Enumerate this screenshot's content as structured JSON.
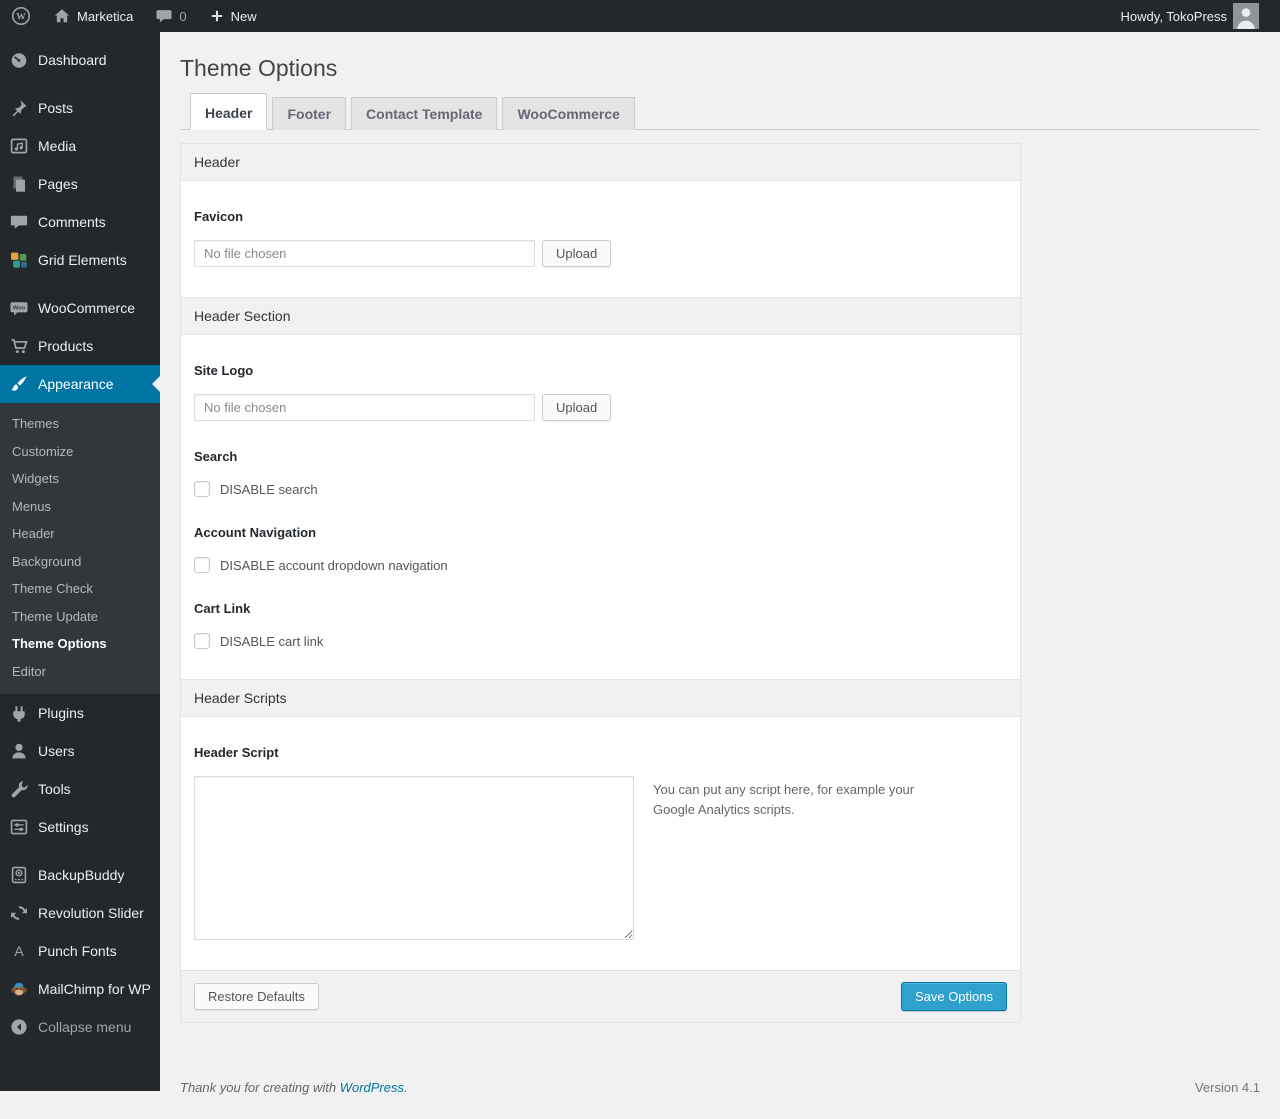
{
  "colors": {
    "admin_bar_bg": "#23282d",
    "sidebar_bg": "#23282d",
    "submenu_bg": "#32373c",
    "accent": "#0074a2",
    "primary_button": "#2ea2cc",
    "content_bg": "#f1f1f1"
  },
  "admin_bar": {
    "site_name": "Marketica",
    "comment_count": "0",
    "new_label": "New",
    "howdy": "Howdy, TokoPress"
  },
  "sidebar": {
    "items": [
      {
        "label": "Dashboard",
        "icon": "dashboard-icon"
      },
      {
        "label": "Posts",
        "icon": "pin-icon"
      },
      {
        "label": "Media",
        "icon": "media-icon"
      },
      {
        "label": "Pages",
        "icon": "pages-icon"
      },
      {
        "label": "Comments",
        "icon": "comment-icon"
      },
      {
        "label": "Grid Elements",
        "icon": "grid-icon"
      },
      {
        "label": "WooCommerce",
        "icon": "woocommerce-icon"
      },
      {
        "label": "Products",
        "icon": "cart-icon"
      },
      {
        "label": "Appearance",
        "icon": "brush-icon",
        "active": true
      },
      {
        "label": "Plugins",
        "icon": "plug-icon"
      },
      {
        "label": "Users",
        "icon": "user-icon"
      },
      {
        "label": "Tools",
        "icon": "wrench-icon"
      },
      {
        "label": "Settings",
        "icon": "settings-icon"
      },
      {
        "label": "BackupBuddy",
        "icon": "backup-drive-icon"
      },
      {
        "label": "Revolution Slider",
        "icon": "refresh-icon"
      },
      {
        "label": "Punch Fonts",
        "icon": "letter-a-icon"
      },
      {
        "label": "MailChimp for WP",
        "icon": "monkey-icon"
      },
      {
        "label": "Collapse menu",
        "icon": "collapse-icon"
      }
    ],
    "submenu": [
      "Themes",
      "Customize",
      "Widgets",
      "Menus",
      "Header",
      "Background",
      "Theme Check",
      "Theme Update",
      "Theme Options",
      "Editor"
    ],
    "submenu_current": "Theme Options"
  },
  "page": {
    "title": "Theme Options",
    "tabs": [
      "Header",
      "Footer",
      "Contact Template",
      "WooCommerce"
    ],
    "active_tab": "Header"
  },
  "panel": {
    "sections": {
      "header": {
        "title": "Header"
      },
      "header_section": {
        "title": "Header Section"
      },
      "header_scripts": {
        "title": "Header Scripts"
      }
    },
    "fields": {
      "favicon": {
        "label": "Favicon",
        "file_value": "No file chosen",
        "upload_label": "Upload"
      },
      "site_logo": {
        "label": "Site Logo",
        "file_value": "No file chosen",
        "upload_label": "Upload"
      },
      "search": {
        "label": "Search",
        "checkbox_label": "DISABLE search",
        "checked": false
      },
      "account_nav": {
        "label": "Account Navigation",
        "checkbox_label": "DISABLE account dropdown navigation",
        "checked": false
      },
      "cart_link": {
        "label": "Cart Link",
        "checkbox_label": "DISABLE cart link",
        "checked": false
      },
      "header_script": {
        "label": "Header Script",
        "value": "",
        "help": "You can put any script here, for example your Google Analytics scripts."
      }
    },
    "footer": {
      "restore_label": "Restore Defaults",
      "save_label": "Save Options"
    }
  },
  "footer": {
    "thanks_prefix": "Thank you for creating with ",
    "link_text": "WordPress",
    "suffix": ".",
    "version": "Version 4.1"
  }
}
